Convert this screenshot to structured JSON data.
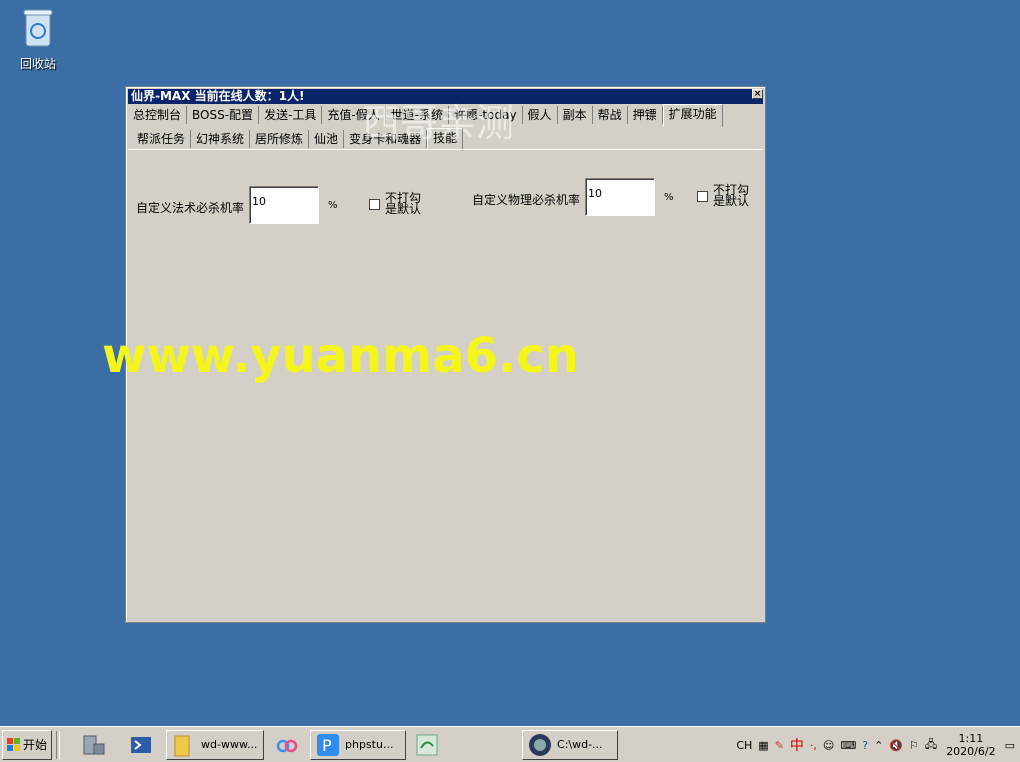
{
  "desktop": {
    "recycle_bin_label": "回收站"
  },
  "window": {
    "title": "仙界-MAX   当前在线人数：1人!",
    "tabs_row1": [
      "总控制台",
      "BOSS-配置",
      "发送-工具",
      "充值-假人",
      "世道-系统",
      "许愿-today",
      "假人",
      "副本",
      "帮战",
      "押镖",
      "扩展功能"
    ],
    "tabs_row2": [
      "帮派任务",
      "幻神系统",
      "居所修炼",
      "仙池",
      "变身卡和魂器",
      "技能"
    ],
    "active_tab_row1": "扩展功能",
    "active_tab_row2": "技能",
    "magic_kill_label": "自定义法术必杀机率",
    "magic_kill_value": "10",
    "magic_pct": "%",
    "magic_chk_label": "不打勾是默认",
    "phys_kill_label": "自定义物理必杀机率",
    "phys_kill_value": "10",
    "phys_pct": "%",
    "phys_chk_label": "不打勾是默认"
  },
  "watermarks": {
    "w1": "西哥亲测",
    "w2": "www.yuanma6.cn"
  },
  "taskbar": {
    "start_label": "开始",
    "items": [
      "wd-www...",
      "phpstu...",
      "C:\\wd-..."
    ],
    "tray_lang": "CH",
    "tray_ime": "中",
    "time": "1:11",
    "date": "2020/6/2"
  }
}
